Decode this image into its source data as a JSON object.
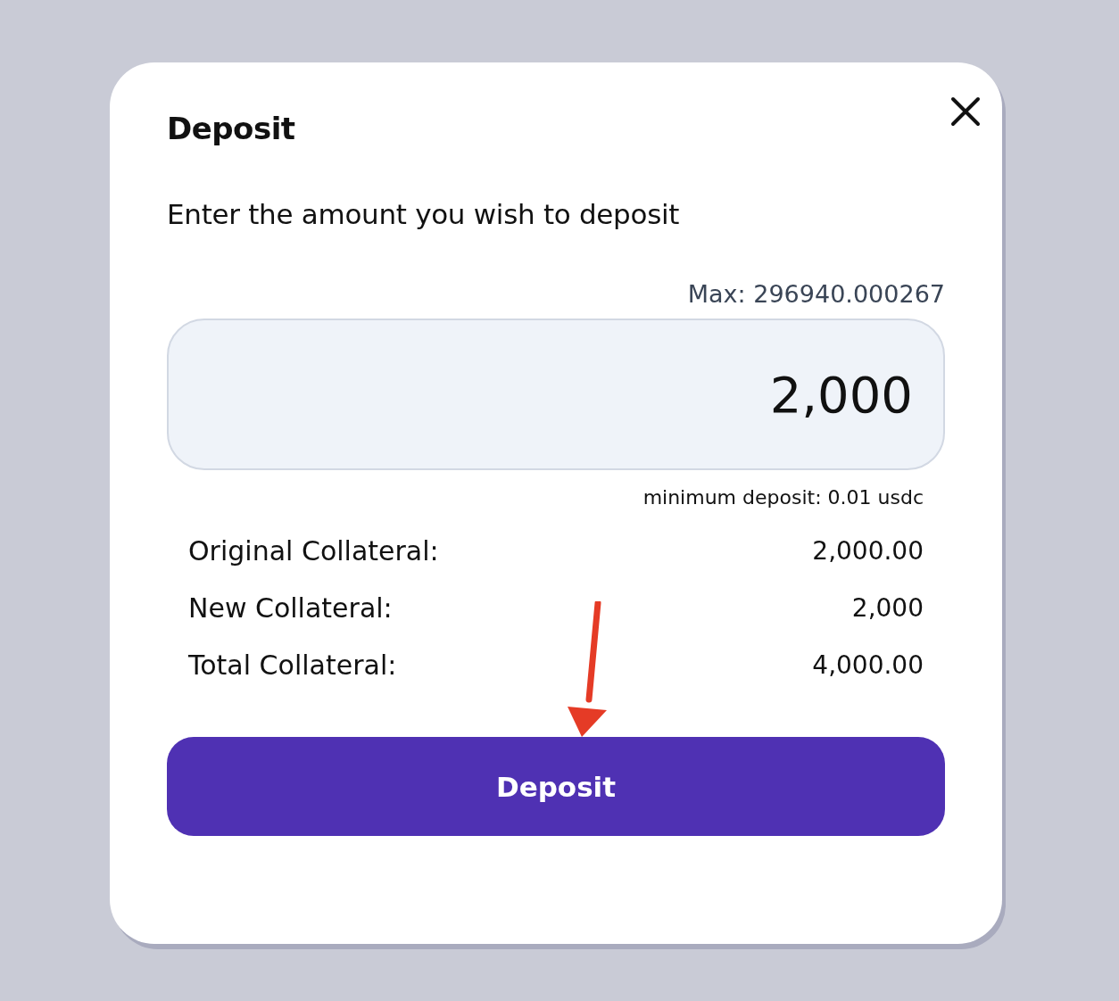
{
  "title": "Deposit",
  "prompt": "Enter the amount you wish to deposit",
  "max": "Max: 296940.000267",
  "amount": {
    "value": "2,000"
  },
  "minimum_note": "minimum deposit: 0.01 usdc",
  "summary": [
    {
      "label": "Original Collateral:",
      "value": "2,000.00"
    },
    {
      "label": "New Collateral:",
      "value": "2,000"
    },
    {
      "label": "Total Collateral:",
      "value": "4,000.00"
    }
  ],
  "button": "Deposit"
}
